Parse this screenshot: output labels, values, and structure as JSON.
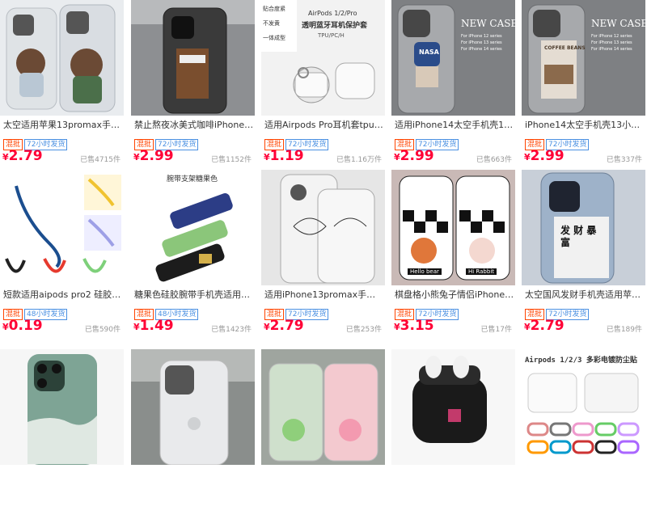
{
  "products": [
    {
      "title": "太空适用苹果13promax手机壳1…",
      "badge": "混批",
      "ship": "72小时发货",
      "price": "2.79",
      "sold": "已售4715件"
    },
    {
      "title": "禁止熬夜冰美式咖啡iPhone14太…",
      "badge": "混批",
      "ship": "72小时发货",
      "price": "2.99",
      "sold": "已售1152件"
    },
    {
      "title": "适用Airpods Pro耳机套tpu苹果…",
      "badge": "混批",
      "ship": "72小时发货",
      "price": "1.19",
      "sold": "已售1.16万件"
    },
    {
      "title": "适用iPhone14太空手机壳13小众…",
      "badge": "混批",
      "ship": "72小时发货",
      "price": "2.99",
      "sold": "已售663件"
    },
    {
      "title": "iPhone14太空手机壳13小众高级…",
      "badge": "混批",
      "ship": "72小时发货",
      "price": "2.99",
      "sold": "已售337件"
    },
    {
      "title": "短款适用aipods pro2 硅胶民族…",
      "badge": "混批",
      "ship": "48小时发货",
      "price": "0.19",
      "sold": "已售590件"
    },
    {
      "title": "糖果色硅胶腕带手机壳适用苹果…",
      "badge": "混批",
      "ship": "48小时发货",
      "price": "1.49",
      "sold": "已售1423件"
    },
    {
      "title": "适用iPhone13promax手机壳12…",
      "badge": "混批",
      "ship": "72小时发货",
      "price": "2.79",
      "sold": "已售253件"
    },
    {
      "title": "棋盘格小熊兔子情侣iPhone14太…",
      "badge": "混批",
      "ship": "72小时发货",
      "price": "3.15",
      "sold": "已售17件"
    },
    {
      "title": "太空国风发财手机壳适用苹果14…",
      "badge": "混批",
      "ship": "72小时发货",
      "price": "2.79",
      "sold": "已售189件"
    },
    {
      "title": "",
      "badge": "",
      "ship": "",
      "price": "",
      "sold": ""
    },
    {
      "title": "",
      "badge": "",
      "ship": "",
      "price": "",
      "sold": ""
    },
    {
      "title": "",
      "badge": "",
      "ship": "",
      "price": "",
      "sold": ""
    },
    {
      "title": "",
      "badge": "",
      "ship": "",
      "price": "",
      "sold": ""
    },
    {
      "title": "",
      "badge": "",
      "ship": "",
      "price": "",
      "sold": ""
    }
  ],
  "currency": "¥",
  "overlays": {
    "airpods_top": "AirPods 1/2/Pro",
    "airpods_sub": "透明蓝牙耳机保护套",
    "airpods_tag1": "贴合度紧",
    "airpods_tag2": "不发黄",
    "airpods_tag3": "一体成型",
    "airpods_mat": "TPU/PC/H",
    "newcase": "NEW CASE",
    "series1": "For iPhone 12 series",
    "series2": "For iPhone 13 series",
    "series3": "For iPhone 14 series",
    "strap_header": "腕带支架糖果色",
    "coffee": "COFFEE BEANS",
    "nasa": "NASA",
    "dust_header": "Airpods 1/2/3 多彩电镀防尘贴",
    "hello_bear": "Hello bear",
    "hi_rabbit": "Hi Rabbit",
    "fortune": "发 财 暴 富"
  }
}
